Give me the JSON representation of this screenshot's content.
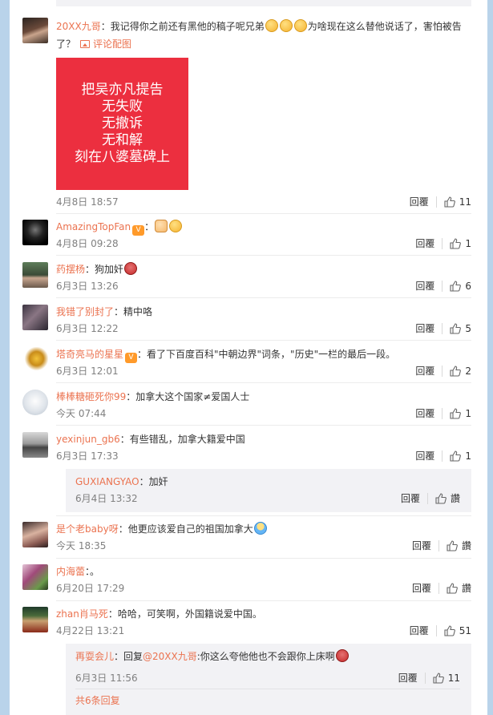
{
  "poster_lines": [
    "把吴亦凡提告",
    "无失败",
    "无撤诉",
    "无和解",
    "刻在八婆墓碑上"
  ],
  "labels": {
    "reply": "回覆",
    "like_zan": "讚"
  },
  "comments": [
    {
      "user": "20XX九哥",
      "text_a": "：我记得你之前还有黑他的稿子呢兄弟",
      "text_b": "为啥现在这么替他说话了，害怕被告",
      "text_c": "了？",
      "photo_label": "评论配图",
      "time": "4月8日 18:57",
      "likes": "11"
    },
    {
      "user": "AmazingTopFan",
      "text": "：",
      "time": "4月8日 09:28",
      "likes": "1",
      "badge": "V"
    },
    {
      "user": "药摆杨",
      "text": "：狗加奸",
      "time": "6月3日 13:26",
      "likes": "6"
    },
    {
      "user": "我错了别封了",
      "text": "：精中咯",
      "time": "6月3日 12:22",
      "likes": "5"
    },
    {
      "user": "塔奇亮马的星星",
      "text": "：看了下百度百科\"中朝边界\"词条，\"历史\"一栏的最后一段。",
      "time": "6月3日 12:01",
      "likes": "2",
      "badge": "V"
    },
    {
      "user": "棒棒糖砸死你99",
      "text": "：加拿大这个国家≠爱国人士",
      "time": "今天 07:44",
      "likes": "1"
    },
    {
      "user": "yexinjun_gb6",
      "text": "：有些错乱，加拿大籍爱中国",
      "time": "6月3日 17:33",
      "likes": "1"
    },
    {
      "user": "是个老baby呀",
      "text": "：他更应该爱自己的祖国加拿大",
      "time": "今天 18:35"
    },
    {
      "user": "内海蕾",
      "text": "：。",
      "time": "6月20日 17:29"
    },
    {
      "user": "zhan肖马死",
      "text": "：哈哈，可笑啊，外国籍说爱中国。",
      "time": "4月22日 13:21",
      "likes": "51"
    }
  ],
  "replies": [
    {
      "user": "GUXIANGYAO",
      "text": "：加奸",
      "time": "6月4日 13:32"
    },
    {
      "user": "再耍会儿",
      "prefix": "：回复",
      "mention": "@20XX九哥",
      "text": ":你这么夸他他也不会跟你上床啊",
      "time": "6月3日 11:56",
      "likes": "11"
    }
  ],
  "more_replies": "共6条回复",
  "colors": {
    "link": "#eb7350",
    "poster": "#ec2f3f",
    "page_bg": "#b9d3ea"
  }
}
